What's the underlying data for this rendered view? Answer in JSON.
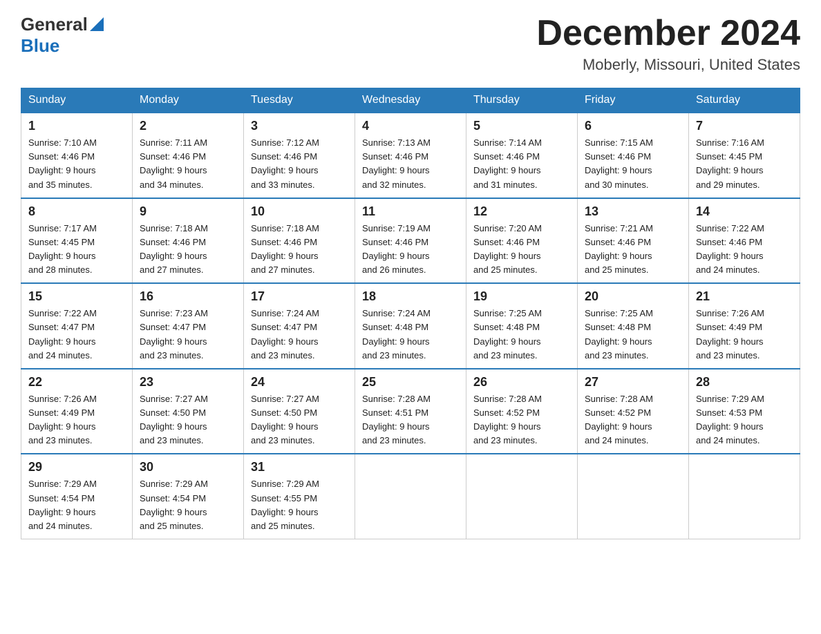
{
  "header": {
    "logo_general": "General",
    "logo_blue": "Blue",
    "month_year": "December 2024",
    "location": "Moberly, Missouri, United States"
  },
  "weekdays": [
    "Sunday",
    "Monday",
    "Tuesday",
    "Wednesday",
    "Thursday",
    "Friday",
    "Saturday"
  ],
  "weeks": [
    [
      {
        "day": "1",
        "sunrise": "7:10 AM",
        "sunset": "4:46 PM",
        "daylight": "9 hours and 35 minutes."
      },
      {
        "day": "2",
        "sunrise": "7:11 AM",
        "sunset": "4:46 PM",
        "daylight": "9 hours and 34 minutes."
      },
      {
        "day": "3",
        "sunrise": "7:12 AM",
        "sunset": "4:46 PM",
        "daylight": "9 hours and 33 minutes."
      },
      {
        "day": "4",
        "sunrise": "7:13 AM",
        "sunset": "4:46 PM",
        "daylight": "9 hours and 32 minutes."
      },
      {
        "day": "5",
        "sunrise": "7:14 AM",
        "sunset": "4:46 PM",
        "daylight": "9 hours and 31 minutes."
      },
      {
        "day": "6",
        "sunrise": "7:15 AM",
        "sunset": "4:46 PM",
        "daylight": "9 hours and 30 minutes."
      },
      {
        "day": "7",
        "sunrise": "7:16 AM",
        "sunset": "4:45 PM",
        "daylight": "9 hours and 29 minutes."
      }
    ],
    [
      {
        "day": "8",
        "sunrise": "7:17 AM",
        "sunset": "4:45 PM",
        "daylight": "9 hours and 28 minutes."
      },
      {
        "day": "9",
        "sunrise": "7:18 AM",
        "sunset": "4:46 PM",
        "daylight": "9 hours and 27 minutes."
      },
      {
        "day": "10",
        "sunrise": "7:18 AM",
        "sunset": "4:46 PM",
        "daylight": "9 hours and 27 minutes."
      },
      {
        "day": "11",
        "sunrise": "7:19 AM",
        "sunset": "4:46 PM",
        "daylight": "9 hours and 26 minutes."
      },
      {
        "day": "12",
        "sunrise": "7:20 AM",
        "sunset": "4:46 PM",
        "daylight": "9 hours and 25 minutes."
      },
      {
        "day": "13",
        "sunrise": "7:21 AM",
        "sunset": "4:46 PM",
        "daylight": "9 hours and 25 minutes."
      },
      {
        "day": "14",
        "sunrise": "7:22 AM",
        "sunset": "4:46 PM",
        "daylight": "9 hours and 24 minutes."
      }
    ],
    [
      {
        "day": "15",
        "sunrise": "7:22 AM",
        "sunset": "4:47 PM",
        "daylight": "9 hours and 24 minutes."
      },
      {
        "day": "16",
        "sunrise": "7:23 AM",
        "sunset": "4:47 PM",
        "daylight": "9 hours and 23 minutes."
      },
      {
        "day": "17",
        "sunrise": "7:24 AM",
        "sunset": "4:47 PM",
        "daylight": "9 hours and 23 minutes."
      },
      {
        "day": "18",
        "sunrise": "7:24 AM",
        "sunset": "4:48 PM",
        "daylight": "9 hours and 23 minutes."
      },
      {
        "day": "19",
        "sunrise": "7:25 AM",
        "sunset": "4:48 PM",
        "daylight": "9 hours and 23 minutes."
      },
      {
        "day": "20",
        "sunrise": "7:25 AM",
        "sunset": "4:48 PM",
        "daylight": "9 hours and 23 minutes."
      },
      {
        "day": "21",
        "sunrise": "7:26 AM",
        "sunset": "4:49 PM",
        "daylight": "9 hours and 23 minutes."
      }
    ],
    [
      {
        "day": "22",
        "sunrise": "7:26 AM",
        "sunset": "4:49 PM",
        "daylight": "9 hours and 23 minutes."
      },
      {
        "day": "23",
        "sunrise": "7:27 AM",
        "sunset": "4:50 PM",
        "daylight": "9 hours and 23 minutes."
      },
      {
        "day": "24",
        "sunrise": "7:27 AM",
        "sunset": "4:50 PM",
        "daylight": "9 hours and 23 minutes."
      },
      {
        "day": "25",
        "sunrise": "7:28 AM",
        "sunset": "4:51 PM",
        "daylight": "9 hours and 23 minutes."
      },
      {
        "day": "26",
        "sunrise": "7:28 AM",
        "sunset": "4:52 PM",
        "daylight": "9 hours and 23 minutes."
      },
      {
        "day": "27",
        "sunrise": "7:28 AM",
        "sunset": "4:52 PM",
        "daylight": "9 hours and 24 minutes."
      },
      {
        "day": "28",
        "sunrise": "7:29 AM",
        "sunset": "4:53 PM",
        "daylight": "9 hours and 24 minutes."
      }
    ],
    [
      {
        "day": "29",
        "sunrise": "7:29 AM",
        "sunset": "4:54 PM",
        "daylight": "9 hours and 24 minutes."
      },
      {
        "day": "30",
        "sunrise": "7:29 AM",
        "sunset": "4:54 PM",
        "daylight": "9 hours and 25 minutes."
      },
      {
        "day": "31",
        "sunrise": "7:29 AM",
        "sunset": "4:55 PM",
        "daylight": "9 hours and 25 minutes."
      },
      null,
      null,
      null,
      null
    ]
  ],
  "labels": {
    "sunrise_prefix": "Sunrise: ",
    "sunset_prefix": "Sunset: ",
    "daylight_prefix": "Daylight: "
  }
}
